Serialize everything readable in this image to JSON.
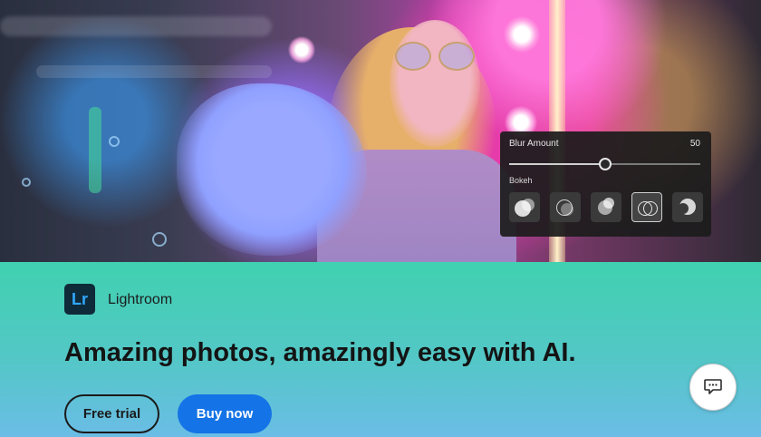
{
  "hero": {
    "panel": {
      "blur_label": "Blur Amount",
      "blur_value": "50",
      "blur_level": 0.5,
      "bokeh_label": "Bokeh",
      "bokeh_options": [
        "bokeh-circle",
        "bokeh-ring",
        "bokeh-half",
        "bokeh-double-ring",
        "bokeh-cat-eye"
      ],
      "selected_option": 3
    }
  },
  "banner": {
    "app_logo": "Lr",
    "app_name": "Lightroom",
    "headline": "Amazing photos, amazingly easy with AI.",
    "free_trial_label": "Free trial",
    "buy_now_label": "Buy now",
    "chat_icon": "chat-bubble-icon"
  },
  "colors": {
    "banner_top": "#40d1b0",
    "banner_bottom": "#6bbde6",
    "primary_button": "#1473e6",
    "logo_bg": "#0f2a38",
    "logo_text": "#31a8ff"
  }
}
